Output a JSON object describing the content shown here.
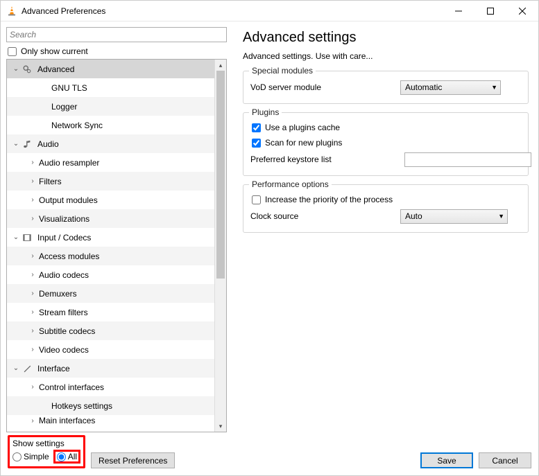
{
  "window": {
    "title": "Advanced Preferences"
  },
  "left": {
    "search_placeholder": "Search",
    "only_show_current": "Only show current"
  },
  "tree": [
    {
      "label": "Advanced",
      "level": 0,
      "expanded": "open",
      "icon": "gears",
      "selected": true
    },
    {
      "label": "GNU TLS",
      "level": 1
    },
    {
      "label": "Logger",
      "level": 1
    },
    {
      "label": "Network Sync",
      "level": 1
    },
    {
      "label": "Audio",
      "level": 0,
      "expanded": "open",
      "icon": "note"
    },
    {
      "label": "Audio resampler",
      "level": 2,
      "expanded": "closed"
    },
    {
      "label": "Filters",
      "level": 2,
      "expanded": "closed"
    },
    {
      "label": "Output modules",
      "level": 2,
      "expanded": "closed"
    },
    {
      "label": "Visualizations",
      "level": 2,
      "expanded": "closed"
    },
    {
      "label": "Input / Codecs",
      "level": 0,
      "expanded": "open",
      "icon": "film"
    },
    {
      "label": "Access modules",
      "level": 2,
      "expanded": "closed"
    },
    {
      "label": "Audio codecs",
      "level": 2,
      "expanded": "closed"
    },
    {
      "label": "Demuxers",
      "level": 2,
      "expanded": "closed"
    },
    {
      "label": "Stream filters",
      "level": 2,
      "expanded": "closed"
    },
    {
      "label": "Subtitle codecs",
      "level": 2,
      "expanded": "closed"
    },
    {
      "label": "Video codecs",
      "level": 2,
      "expanded": "closed"
    },
    {
      "label": "Interface",
      "level": 0,
      "expanded": "open",
      "icon": "brush"
    },
    {
      "label": "Control interfaces",
      "level": 2,
      "expanded": "closed"
    },
    {
      "label": "Hotkeys settings",
      "level": 1
    },
    {
      "label": "Main interfaces",
      "level": 2,
      "expanded": "closed",
      "cut": true
    }
  ],
  "panel": {
    "heading": "Advanced settings",
    "description": "Advanced settings. Use with care...",
    "group1": {
      "legend": "Special modules",
      "vod_label": "VoD server module",
      "vod_value": "Automatic"
    },
    "group2": {
      "legend": "Plugins",
      "use_cache": "Use a plugins cache",
      "scan_new": "Scan for new plugins",
      "keystore_label": "Preferred keystore list"
    },
    "group3": {
      "legend": "Performance options",
      "priority": "Increase the priority of the process",
      "clock_label": "Clock source",
      "clock_value": "Auto"
    }
  },
  "footer": {
    "show_settings": "Show settings",
    "simple": "Simple",
    "all": "All",
    "reset": "Reset Preferences",
    "save": "Save",
    "cancel": "Cancel"
  }
}
